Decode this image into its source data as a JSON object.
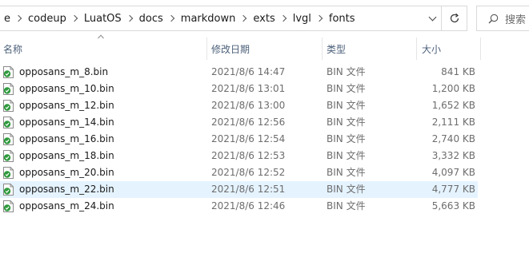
{
  "address_bar": {
    "crumbs": [
      "e",
      "codeup",
      "LuatOS",
      "docs",
      "markdown",
      "exts",
      "lvgl",
      "fonts"
    ]
  },
  "search": {
    "placeholder": "搜索"
  },
  "columns": {
    "name": "名称",
    "date": "修改日期",
    "type": "类型",
    "size": "大小"
  },
  "files": [
    {
      "name": "opposans_m_8.bin",
      "date": "2021/8/6 14:47",
      "type": "BIN 文件",
      "size": "841 KB"
    },
    {
      "name": "opposans_m_10.bin",
      "date": "2021/8/6 13:01",
      "type": "BIN 文件",
      "size": "1,200 KB"
    },
    {
      "name": "opposans_m_12.bin",
      "date": "2021/8/6 13:00",
      "type": "BIN 文件",
      "size": "1,652 KB"
    },
    {
      "name": "opposans_m_14.bin",
      "date": "2021/8/6 12:56",
      "type": "BIN 文件",
      "size": "2,111 KB"
    },
    {
      "name": "opposans_m_16.bin",
      "date": "2021/8/6 12:54",
      "type": "BIN 文件",
      "size": "2,740 KB"
    },
    {
      "name": "opposans_m_18.bin",
      "date": "2021/8/6 12:53",
      "type": "BIN 文件",
      "size": "3,332 KB"
    },
    {
      "name": "opposans_m_20.bin",
      "date": "2021/8/6 12:52",
      "type": "BIN 文件",
      "size": "4,097 KB"
    },
    {
      "name": "opposans_m_22.bin",
      "date": "2021/8/6 12:51",
      "type": "BIN 文件",
      "size": "4,777 KB"
    },
    {
      "name": "opposans_m_24.bin",
      "date": "2021/8/6 12:46",
      "type": "BIN 文件",
      "size": "5,663 KB"
    }
  ],
  "selected_row": 7,
  "colors": {
    "selection": "#e5f3ff",
    "header_text": "#4c607a",
    "secondary_text": "#6d6d6d",
    "icon_green": "#2e9a3c"
  },
  "icons": {
    "file": "bin-file-icon",
    "refresh": "refresh-icon",
    "search": "search-icon",
    "dropdown": "chevron-down-icon",
    "separator": "chevron-right-icon",
    "sort": "sort-ascending-icon"
  }
}
